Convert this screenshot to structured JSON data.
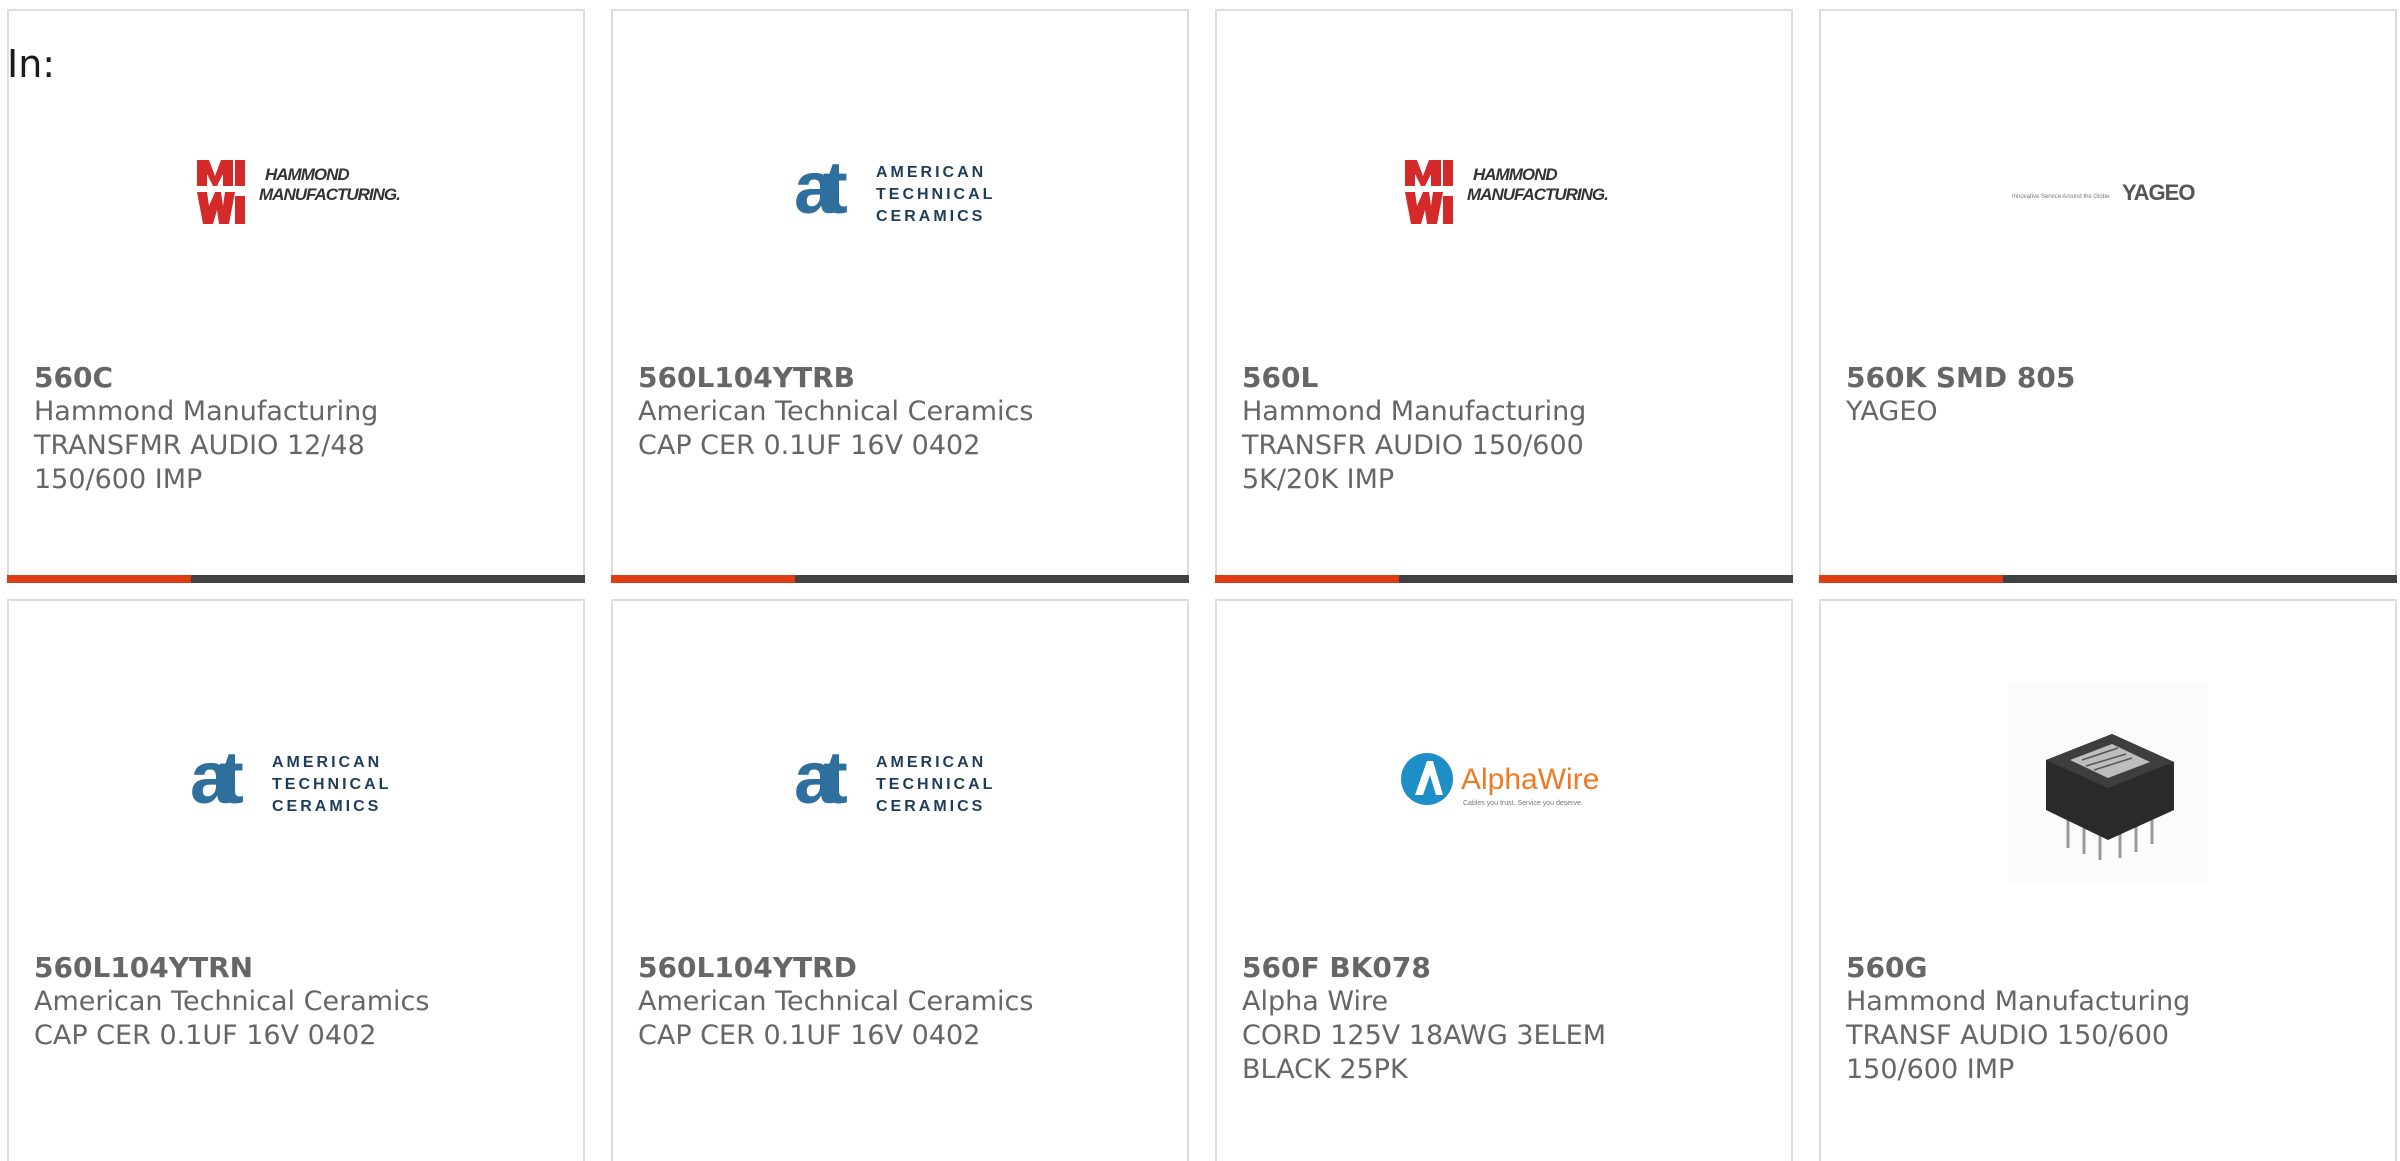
{
  "filter": {
    "label": "In:"
  },
  "products": [
    {
      "part_number": "560C",
      "manufacturer": "Hammond Manufacturing",
      "description": "TRANSFMR AUDIO 12/48 150/600 IMP",
      "logo": "hammond-logo"
    },
    {
      "part_number": "560L104YTRB",
      "manufacturer": "American Technical Ceramics",
      "description": "CAP CER 0.1UF 16V 0402",
      "logo": "atc-logo"
    },
    {
      "part_number": "560L",
      "manufacturer": "Hammond Manufacturing",
      "description": "TRANSFR AUDIO 150/600 5K/20K IMP",
      "logo": "hammond-logo"
    },
    {
      "part_number": "560K SMD 805",
      "manufacturer": "YAGEO",
      "description": "",
      "logo": "yageo-logo"
    },
    {
      "part_number": "560L104YTRN",
      "manufacturer": "American Technical Ceramics",
      "description": "CAP CER 0.1UF 16V 0402",
      "logo": "atc-logo"
    },
    {
      "part_number": "560L104YTRD",
      "manufacturer": "American Technical Ceramics",
      "description": "CAP CER 0.1UF 16V 0402",
      "logo": "atc-logo"
    },
    {
      "part_number": "560F BK078",
      "manufacturer": "Alpha Wire",
      "description": "CORD 125V 18AWG 3ELEM BLACK 25PK",
      "logo": "alphawire-logo"
    },
    {
      "part_number": "560G",
      "manufacturer": "Hammond Manufacturing",
      "description": "TRANSF AUDIO 150/600 150/600 IMP",
      "logo": "transformer-product-image"
    }
  ],
  "logos": {
    "hammond": {
      "line1": "HAMMOND",
      "line2": "MANUFACTURING."
    },
    "atc": {
      "line1": "AMERICAN",
      "line2": "TECHNICAL",
      "line3": "CERAMICS",
      "mark": "at"
    },
    "yageo": {
      "tagline": "Innovative Service Around the Globe",
      "name": "YAGEO"
    },
    "alphawire": {
      "name": "AlphaWire",
      "tagline": "Cables you trust. Service you deserve."
    }
  },
  "colors": {
    "accent_bar": "#e03c14",
    "bar_dark": "#414141",
    "text_gray": "#666666",
    "border": "#dddddd",
    "hammond_red": "#d42a2a",
    "atc_blue": "#2e6f9e",
    "alphawire_blue": "#1e8fc6",
    "alphawire_orange": "#f07a22"
  }
}
